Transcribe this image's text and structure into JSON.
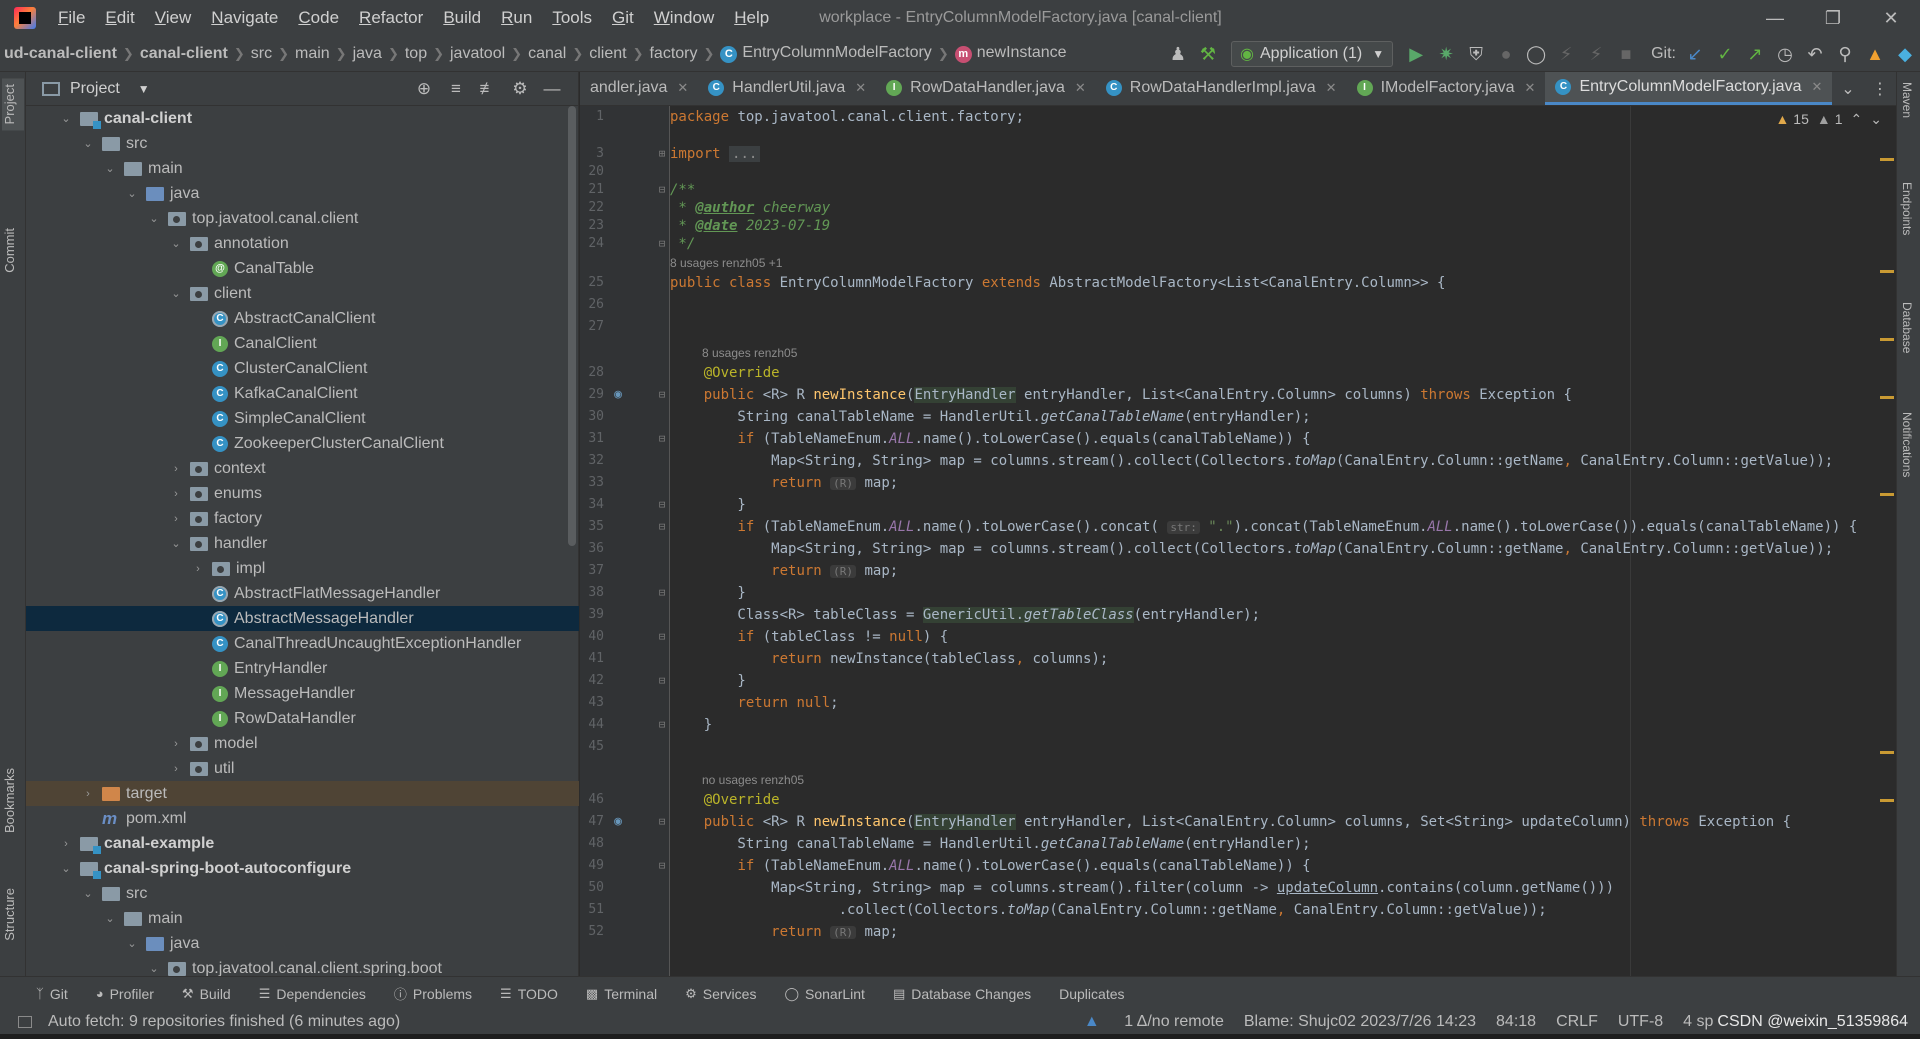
{
  "menubar": {
    "items": [
      "File",
      "Edit",
      "View",
      "Navigate",
      "Code",
      "Refactor",
      "Build",
      "Run",
      "Tools",
      "Git",
      "Window",
      "Help"
    ],
    "title": "workplace - EntryColumnModelFactory.java [canal-client]"
  },
  "navbar": {
    "crumbs": [
      "ud-canal-client",
      "canal-client",
      "src",
      "main",
      "java",
      "top",
      "javatool",
      "canal",
      "client",
      "factory",
      "EntryColumnModelFactory",
      "newInstance"
    ],
    "run_config": "Application (1)",
    "git_label": "Git:"
  },
  "left_strip": {
    "project": "Project",
    "commit": "Commit",
    "bookmarks": "Bookmarks",
    "structure": "Structure"
  },
  "right_strip": {
    "maven": "Maven",
    "endpoints": "Endpoints",
    "database": "Database",
    "notifications": "Notifications"
  },
  "project_panel": {
    "title": "Project",
    "tree": [
      {
        "label": "canal-client",
        "depth": 2,
        "icon": "module",
        "open": true,
        "bold": true
      },
      {
        "label": "src",
        "depth": 3,
        "icon": "folder",
        "open": true
      },
      {
        "label": "main",
        "depth": 4,
        "icon": "folder",
        "open": true
      },
      {
        "label": "java",
        "depth": 5,
        "icon": "folder-src",
        "open": true
      },
      {
        "label": "top.javatool.canal.client",
        "depth": 6,
        "icon": "pkg",
        "open": true
      },
      {
        "label": "annotation",
        "depth": 7,
        "icon": "pkg",
        "open": true
      },
      {
        "label": "CanalTable",
        "depth": 8,
        "icon": "annot"
      },
      {
        "label": "client",
        "depth": 7,
        "icon": "pkg",
        "open": true
      },
      {
        "label": "AbstractCanalClient",
        "depth": 8,
        "icon": "abs"
      },
      {
        "label": "CanalClient",
        "depth": 8,
        "icon": "iface"
      },
      {
        "label": "ClusterCanalClient",
        "depth": 8,
        "icon": "class"
      },
      {
        "label": "KafkaCanalClient",
        "depth": 8,
        "icon": "class"
      },
      {
        "label": "SimpleCanalClient",
        "depth": 8,
        "icon": "class"
      },
      {
        "label": "ZookeeperClusterCanalClient",
        "depth": 8,
        "icon": "class"
      },
      {
        "label": "context",
        "depth": 7,
        "icon": "pkg",
        "open": false
      },
      {
        "label": "enums",
        "depth": 7,
        "icon": "pkg",
        "open": false
      },
      {
        "label": "factory",
        "depth": 7,
        "icon": "pkg",
        "open": false
      },
      {
        "label": "handler",
        "depth": 7,
        "icon": "pkg",
        "open": true
      },
      {
        "label": "impl",
        "depth": 8,
        "icon": "pkg",
        "open": false
      },
      {
        "label": "AbstractFlatMessageHandler",
        "depth": 8,
        "icon": "abs"
      },
      {
        "label": "AbstractMessageHandler",
        "depth": 8,
        "icon": "abs",
        "selected": true
      },
      {
        "label": "CanalThreadUncaughtExceptionHandler",
        "depth": 8,
        "icon": "class"
      },
      {
        "label": "EntryHandler",
        "depth": 8,
        "icon": "iface"
      },
      {
        "label": "MessageHandler",
        "depth": 8,
        "icon": "iface"
      },
      {
        "label": "RowDataHandler",
        "depth": 8,
        "icon": "iface"
      },
      {
        "label": "model",
        "depth": 7,
        "icon": "pkg",
        "open": false
      },
      {
        "label": "util",
        "depth": 7,
        "icon": "pkg",
        "open": false
      },
      {
        "label": "target",
        "depth": 3,
        "icon": "folder-excl",
        "open": false,
        "excluded": true
      },
      {
        "label": "pom.xml",
        "depth": 3,
        "icon": "maven"
      },
      {
        "label": "canal-example",
        "depth": 2,
        "icon": "module",
        "open": false,
        "bold": true
      },
      {
        "label": "canal-spring-boot-autoconfigure",
        "depth": 2,
        "icon": "module",
        "open": true,
        "bold": true
      },
      {
        "label": "src",
        "depth": 3,
        "icon": "folder",
        "open": true
      },
      {
        "label": "main",
        "depth": 4,
        "icon": "folder",
        "open": true
      },
      {
        "label": "java",
        "depth": 5,
        "icon": "folder-src",
        "open": true
      },
      {
        "label": "top.javatool.canal.client.spring.boot",
        "depth": 6,
        "icon": "pkg",
        "open": true
      }
    ]
  },
  "editor_tabs": [
    {
      "label": "andler.java",
      "badge": "",
      "active": false
    },
    {
      "label": "HandlerUtil.java",
      "badge": "C",
      "active": false
    },
    {
      "label": "RowDataHandler.java",
      "badge": "I",
      "active": false
    },
    {
      "label": "RowDataHandlerImpl.java",
      "badge": "C",
      "active": false
    },
    {
      "label": "IModelFactory.java",
      "badge": "I",
      "active": false
    },
    {
      "label": "EntryColumnModelFactory.java",
      "badge": "C",
      "active": true
    }
  ],
  "problems": {
    "warnings": "15",
    "weak_warnings": "1"
  },
  "code_meta": {
    "m1": "8 usages   renzh05 +1",
    "m2": "8 usages   renzh05",
    "m3": "no usages   renzh05"
  },
  "code": {
    "l1": "1",
    "l3": "3",
    "l20": "20",
    "l21": "21",
    "l22": "22",
    "l23": "23",
    "l24": "24",
    "l25": "25",
    "l26": "26",
    "l27": "27",
    "l28": "28",
    "l29": "29",
    "l30": "30",
    "l31": "31",
    "l32": "32",
    "l33": "33",
    "l34": "34",
    "l35": "35",
    "l36": "36",
    "l37": "37",
    "l38": "38",
    "l39": "39",
    "l40": "40",
    "l41": "41",
    "l42": "42",
    "l43": "43",
    "l44": "44",
    "l45": "45",
    "l46": "46",
    "l47": "47",
    "l48": "48",
    "l49": "49",
    "l50": "50",
    "l51": "51",
    "l52": "52"
  },
  "tool_bar": [
    "Git",
    "Profiler",
    "Build",
    "Dependencies",
    "Problems",
    "TODO",
    "Terminal",
    "Services",
    "SonarLint",
    "Database Changes",
    "Duplicates"
  ],
  "status": {
    "left": "Auto fetch: 9 repositories finished (6 minutes ago)",
    "remote": "1 Δ/no remote",
    "blame": "Blame: Shujc02 2023/7/26 14:23",
    "position": "84:18",
    "line_sep": "CRLF",
    "encoding": "UTF-8",
    "indent": "4 sp",
    "watermark": "CSDN @weixin_51359864"
  },
  "colors": {
    "accent": "#4a88c7",
    "selection": "#0d293e",
    "keyword": "#cc7832",
    "annotation": "#bbb529"
  }
}
